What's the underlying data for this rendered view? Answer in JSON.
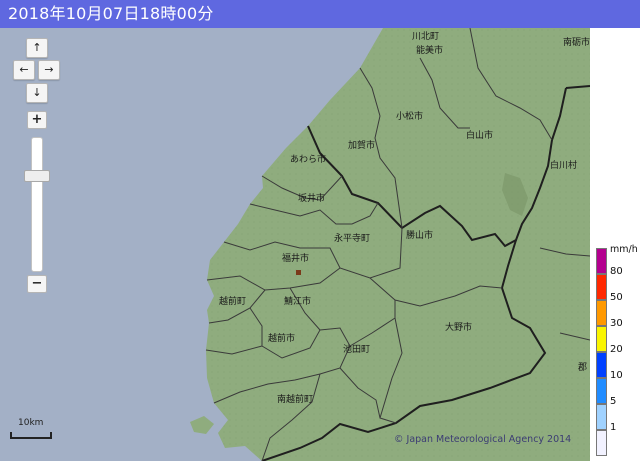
{
  "header": {
    "datetime": "2018年10月07日18時00分",
    "background_color": "#5f68e0"
  },
  "map": {
    "sea_color": "#a3b0c6",
    "land_color": "#8fac7e",
    "place_names": [
      "川北町",
      "能美市",
      "南砺市",
      "小松市",
      "白山市",
      "白川村",
      "加賀市",
      "あわら市",
      "坂井市",
      "永平寺町",
      "勝山市",
      "福井市",
      "越前町",
      "鯖江市",
      "越前市",
      "池田町",
      "大野市",
      "南越前町",
      "郡"
    ]
  },
  "controls": {
    "pan_up": "↑",
    "pan_left": "←",
    "pan_right": "→",
    "pan_down": "↓",
    "zoom_in": "+",
    "zoom_out": "−",
    "zoom_level_fraction": 0.27
  },
  "scale_bar": {
    "label": "10km"
  },
  "attribution": "© Japan Meteorological Agency 2014",
  "legend": {
    "unit": "mm/h",
    "levels": [
      {
        "label": "80",
        "color": "#b4008f"
      },
      {
        "label": "50",
        "color": "#ff2800"
      },
      {
        "label": "30",
        "color": "#ff9900"
      },
      {
        "label": "20",
        "color": "#faf500"
      },
      {
        "label": "10",
        "color": "#0041ff"
      },
      {
        "label": "5",
        "color": "#218cff"
      },
      {
        "label": "1",
        "color": "#a0d2ff"
      },
      {
        "label": "",
        "color": "#f2f2ff"
      }
    ]
  }
}
